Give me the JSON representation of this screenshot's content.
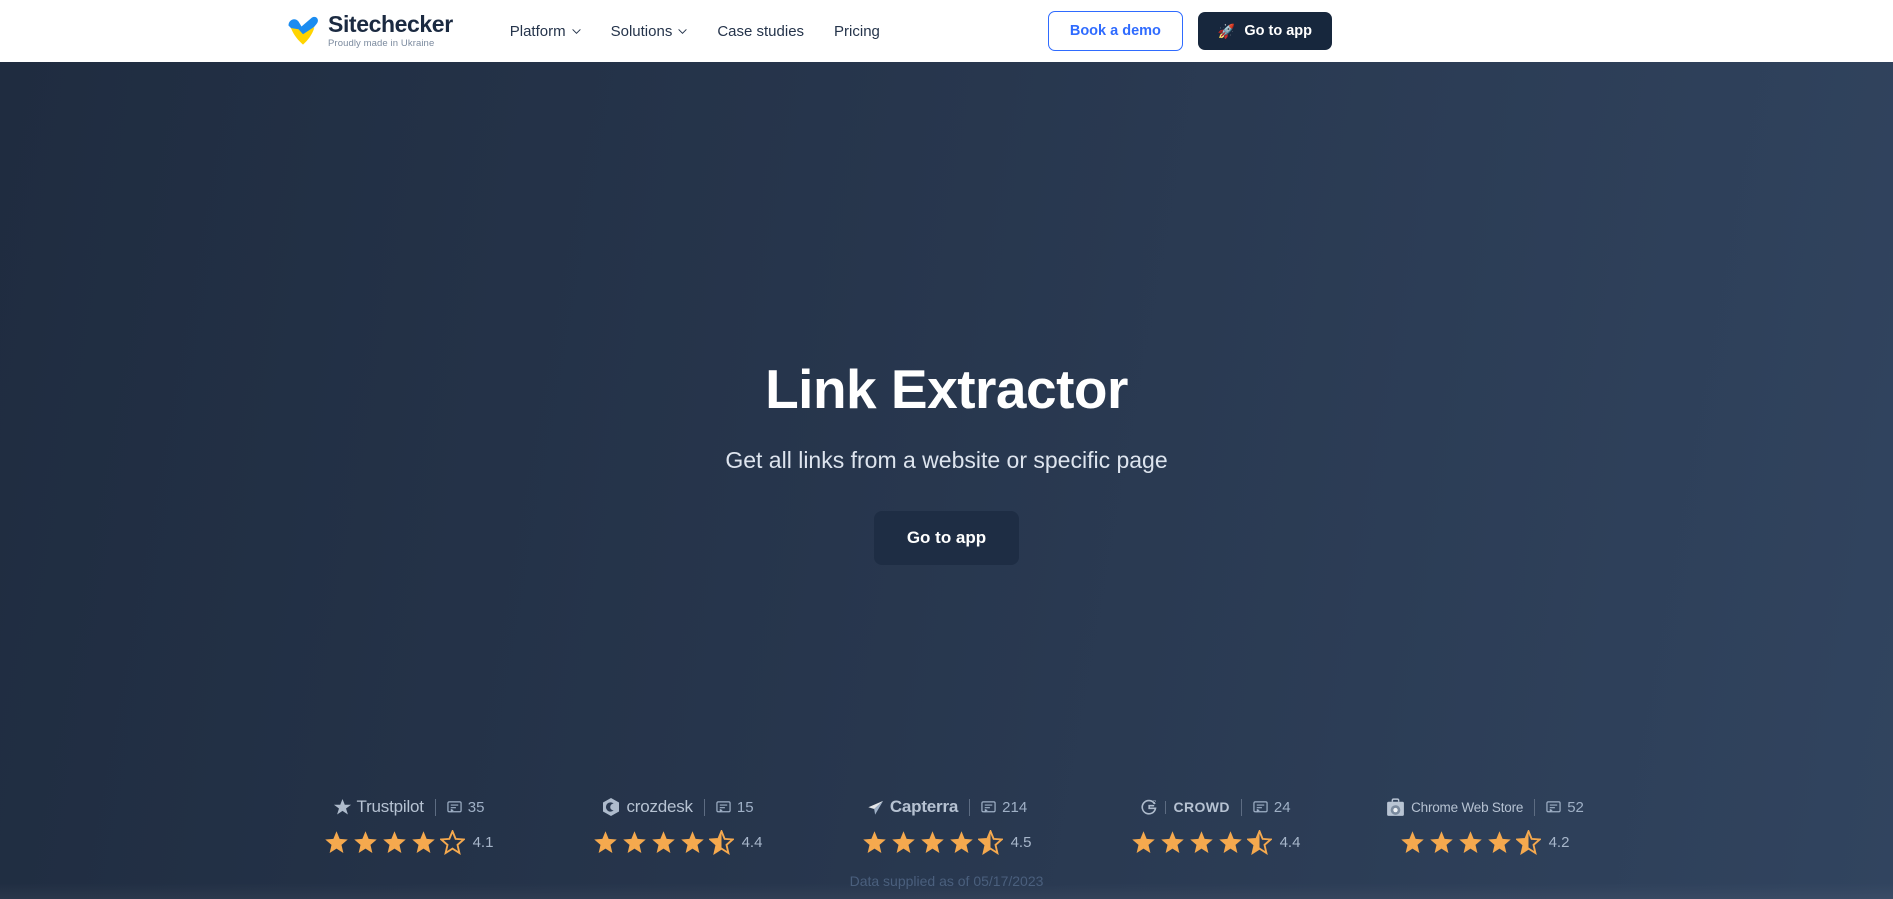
{
  "header": {
    "logo": {
      "name": "Sitechecker",
      "tagline": "Proudly made in Ukraine",
      "icon": "ukraine-heart-check-logo"
    },
    "nav": [
      {
        "label": "Platform",
        "has_dropdown": true
      },
      {
        "label": "Solutions",
        "has_dropdown": true
      },
      {
        "label": "Case studies",
        "has_dropdown": false
      },
      {
        "label": "Pricing",
        "has_dropdown": false
      }
    ],
    "book_demo_label": "Book a demo",
    "go_to_app_label": "Go to app",
    "go_to_app_icon": "rocket-icon"
  },
  "hero": {
    "title": "Link Extractor",
    "subtitle": "Get all links from a website or specific page",
    "cta_label": "Go to app"
  },
  "ratings": {
    "items": [
      {
        "brand": "Trustpilot",
        "brand_icon": "trustpilot-star-icon",
        "review_count": "35",
        "review_icon": "comment-icon",
        "score": "4.1",
        "full_stars": 4,
        "half_star": false,
        "empty_stars": 1
      },
      {
        "brand": "crozdesk",
        "brand_icon": "crozdesk-hexagon-icon",
        "review_count": "15",
        "review_icon": "comment-icon",
        "score": "4.4",
        "full_stars": 4,
        "half_star": true,
        "empty_stars": 0
      },
      {
        "brand": "Capterra",
        "brand_icon": "capterra-arrow-icon",
        "review_count": "214",
        "review_icon": "comment-icon",
        "score": "4.5",
        "full_stars": 4,
        "half_star": true,
        "empty_stars": 0
      },
      {
        "brand": "CROWD",
        "brand_icon": "g2-crowd-icon",
        "review_count": "24",
        "review_icon": "comment-icon",
        "score": "4.4",
        "full_stars": 4,
        "half_star": true,
        "empty_stars": 0
      },
      {
        "brand": "Chrome Web Store",
        "brand_icon": "chrome-web-store-icon",
        "review_count": "52",
        "review_icon": "comment-icon",
        "score": "4.2",
        "full_stars": 4,
        "half_star": true,
        "empty_stars": 0
      }
    ],
    "data_note": "Data supplied as of 05/17/2023"
  },
  "colors": {
    "accent_blue": "#2f6bff",
    "dark_navy": "#17273d",
    "star_orange": "#f5a94e",
    "hero_bg_start": "#1f2c40",
    "hero_bg_end": "#31445f"
  }
}
